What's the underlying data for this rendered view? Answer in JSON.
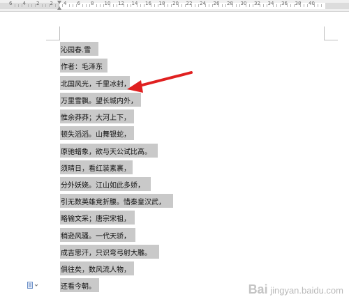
{
  "ruler": {
    "numbers": [
      "6",
      "4",
      "2",
      "2",
      "4",
      "6",
      "8",
      "10",
      "12",
      "14",
      "16",
      "18",
      "20",
      "22",
      "24",
      "26",
      "28",
      "30",
      "32",
      "34",
      "36",
      "38",
      "40"
    ]
  },
  "document": {
    "lines": [
      "沁园春.雪",
      "作者：毛泽东",
      "北国风光，千里冰封，",
      "万里雪飘。望长城内外，",
      "惟余莽莽；大河上下，",
      "顿失滔滔。山舞银蛇，",
      "原驰蜡象，欲与天公试比高。",
      "须晴日，看红装素裹，",
      "分外妖娆。江山如此多娇，",
      "引无数英雄竞折腰。惜秦皇汉武，",
      "略输文采；唐宗宋祖，",
      "稍逊风骚。一代天骄，",
      "成吉思汗，只识弯弓射大雕。",
      "俱往矣，数风流人物，",
      "还看今朝。"
    ]
  },
  "watermark": {
    "text": "Bai",
    "subtext": "jingyan.baidu.com"
  },
  "colors": {
    "selection": "#c9c9c9",
    "arrow": "#e02020"
  }
}
